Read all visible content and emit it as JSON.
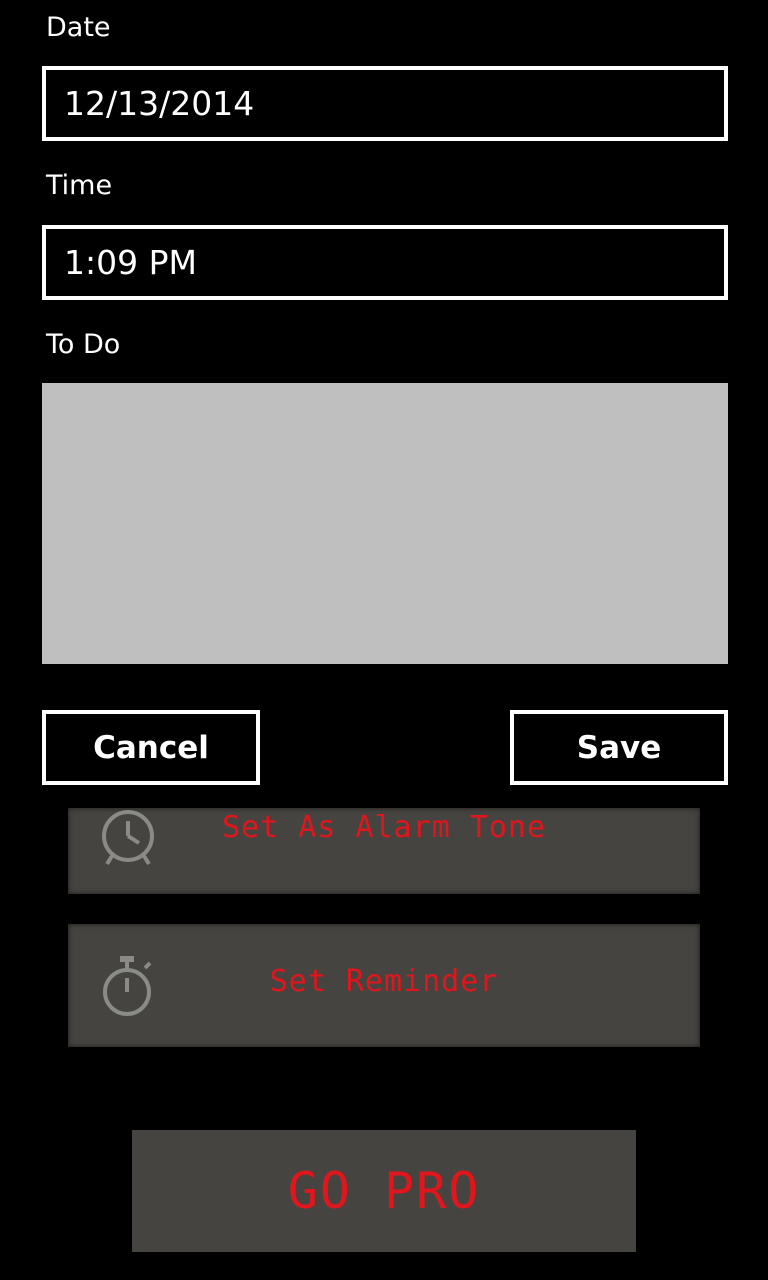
{
  "form": {
    "date_label": "Date",
    "date_value": "12/13/2014",
    "time_label": "Time",
    "time_value": "1:09 PM",
    "todo_label": "To Do",
    "todo_value": ""
  },
  "actions": {
    "cancel_label": "Cancel",
    "save_label": "Save"
  },
  "panels": {
    "alarm_label": "Set As Alarm Tone",
    "alarm_icon": "alarm-clock-icon",
    "reminder_label": "Set Reminder",
    "reminder_icon": "stopwatch-icon",
    "gopro_label": "GO PRO"
  },
  "colors": {
    "background": "#000000",
    "panel": "#464440",
    "accent_text": "#e0161c",
    "todo_fill": "#bfbfbf"
  }
}
